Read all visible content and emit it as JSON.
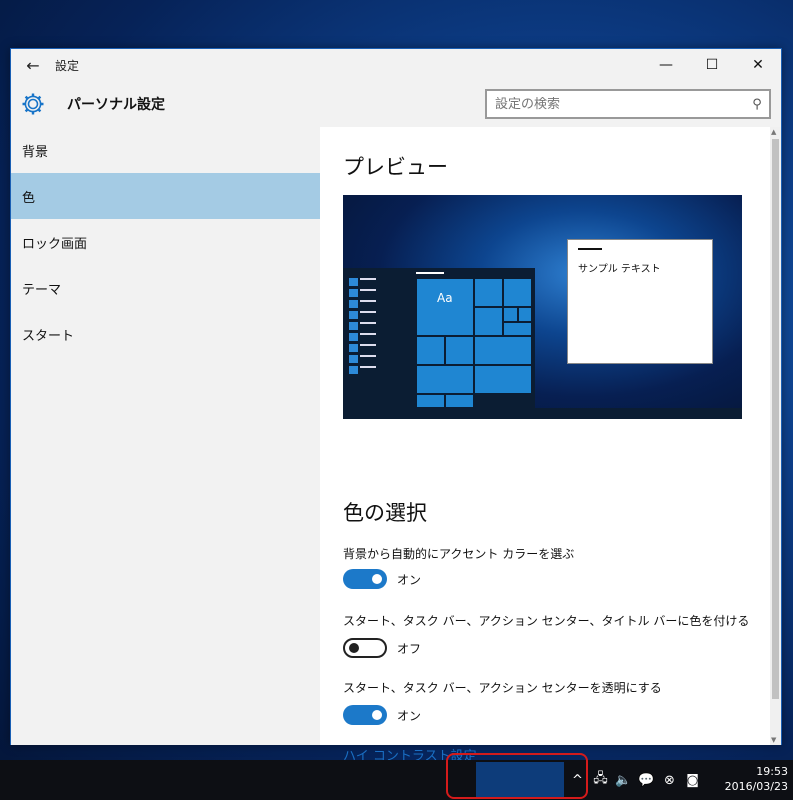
{
  "window": {
    "title": "設定",
    "page_title": "パーソナル設定",
    "controls": {
      "minimize": "—",
      "maximize": "☐",
      "close": "✕"
    }
  },
  "search": {
    "placeholder": "設定の検索"
  },
  "sidebar": {
    "items": [
      {
        "label": "背景",
        "active": false
      },
      {
        "label": "色",
        "active": true
      },
      {
        "label": "ロック画面",
        "active": false
      },
      {
        "label": "テーマ",
        "active": false
      },
      {
        "label": "スタート",
        "active": false
      }
    ]
  },
  "content": {
    "preview_heading": "プレビュー",
    "preview": {
      "tile_label": "Aa",
      "sample_text": "サンプル テキスト"
    },
    "color_heading": "色の選択",
    "settings": [
      {
        "label": "背景から自動的にアクセント カラーを選ぶ",
        "state": "オン",
        "on": true
      },
      {
        "label": "スタート、タスク バー、アクション センター、タイトル バーに色を付ける",
        "state": "オフ",
        "on": false
      },
      {
        "label": "スタート、タスク バー、アクション センターを透明にする",
        "state": "オン",
        "on": true
      }
    ],
    "link": "ハイ コントラスト設定"
  },
  "taskbar": {
    "time": "19:53",
    "date": "2016/03/23"
  },
  "colors": {
    "accent": "#1c79c9",
    "active_nav": "#a4cbe4",
    "link": "#1a6fc4"
  }
}
